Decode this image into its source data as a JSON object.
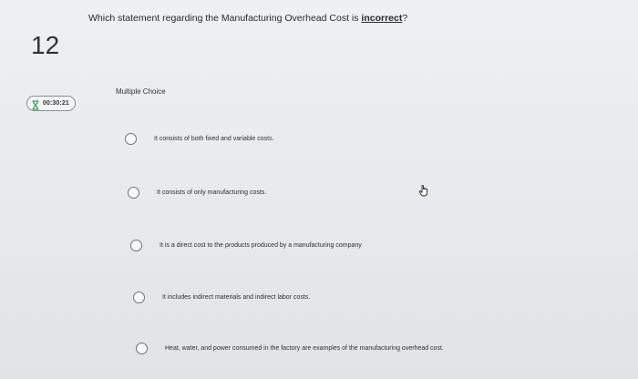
{
  "question": {
    "number": "12",
    "prefix": "Which statement regarding the Manufacturing Overhead Cost is ",
    "emphasis": "incorrect",
    "suffix": "?"
  },
  "timer": {
    "time": "00:30:21",
    "icon": "hourglass-icon"
  },
  "answer_section": {
    "label": "Multiple Choice"
  },
  "options": [
    {
      "text": "It consists of both fixed and variable costs.",
      "selected": false
    },
    {
      "text": "It consists of only manufacturing costs.",
      "selected": false
    },
    {
      "text": "It is a direct cost to the products produced by a manufacturing company",
      "selected": false
    },
    {
      "text": "It includes indirect materials and indirect labor costs.",
      "selected": false
    },
    {
      "text": "Heat, water, and power consumed in the factory are examples of the manufacturing overhead cost.",
      "selected": false
    }
  ],
  "colors": {
    "background": "#e9eaec",
    "radio_border": "#6f7378",
    "timer_icon": "#3aa05a"
  }
}
